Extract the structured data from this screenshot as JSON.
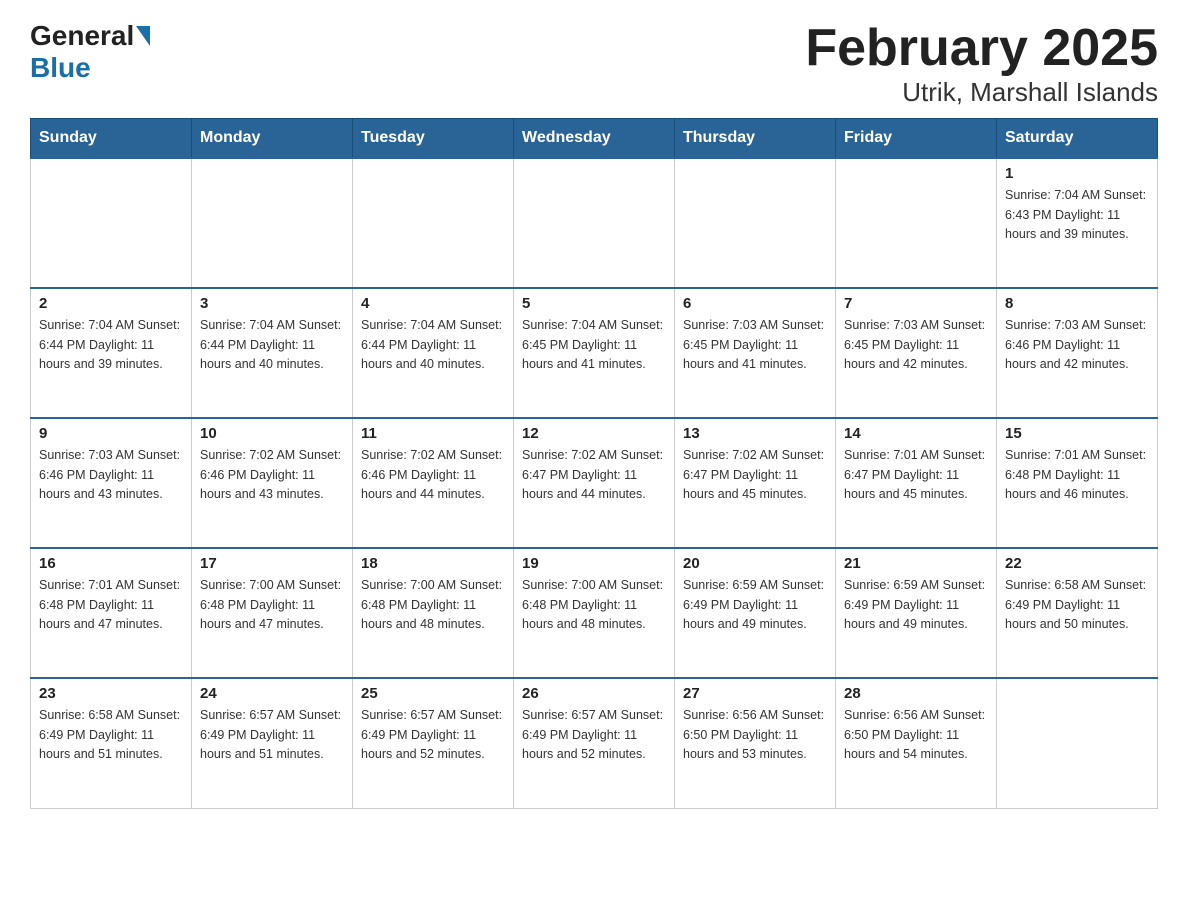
{
  "header": {
    "logo_general": "General",
    "logo_blue": "Blue",
    "title": "February 2025",
    "subtitle": "Utrik, Marshall Islands"
  },
  "weekdays": [
    "Sunday",
    "Monday",
    "Tuesday",
    "Wednesday",
    "Thursday",
    "Friday",
    "Saturday"
  ],
  "weeks": [
    [
      {
        "day": "",
        "info": ""
      },
      {
        "day": "",
        "info": ""
      },
      {
        "day": "",
        "info": ""
      },
      {
        "day": "",
        "info": ""
      },
      {
        "day": "",
        "info": ""
      },
      {
        "day": "",
        "info": ""
      },
      {
        "day": "1",
        "info": "Sunrise: 7:04 AM\nSunset: 6:43 PM\nDaylight: 11 hours\nand 39 minutes."
      }
    ],
    [
      {
        "day": "2",
        "info": "Sunrise: 7:04 AM\nSunset: 6:44 PM\nDaylight: 11 hours\nand 39 minutes."
      },
      {
        "day": "3",
        "info": "Sunrise: 7:04 AM\nSunset: 6:44 PM\nDaylight: 11 hours\nand 40 minutes."
      },
      {
        "day": "4",
        "info": "Sunrise: 7:04 AM\nSunset: 6:44 PM\nDaylight: 11 hours\nand 40 minutes."
      },
      {
        "day": "5",
        "info": "Sunrise: 7:04 AM\nSunset: 6:45 PM\nDaylight: 11 hours\nand 41 minutes."
      },
      {
        "day": "6",
        "info": "Sunrise: 7:03 AM\nSunset: 6:45 PM\nDaylight: 11 hours\nand 41 minutes."
      },
      {
        "day": "7",
        "info": "Sunrise: 7:03 AM\nSunset: 6:45 PM\nDaylight: 11 hours\nand 42 minutes."
      },
      {
        "day": "8",
        "info": "Sunrise: 7:03 AM\nSunset: 6:46 PM\nDaylight: 11 hours\nand 42 minutes."
      }
    ],
    [
      {
        "day": "9",
        "info": "Sunrise: 7:03 AM\nSunset: 6:46 PM\nDaylight: 11 hours\nand 43 minutes."
      },
      {
        "day": "10",
        "info": "Sunrise: 7:02 AM\nSunset: 6:46 PM\nDaylight: 11 hours\nand 43 minutes."
      },
      {
        "day": "11",
        "info": "Sunrise: 7:02 AM\nSunset: 6:46 PM\nDaylight: 11 hours\nand 44 minutes."
      },
      {
        "day": "12",
        "info": "Sunrise: 7:02 AM\nSunset: 6:47 PM\nDaylight: 11 hours\nand 44 minutes."
      },
      {
        "day": "13",
        "info": "Sunrise: 7:02 AM\nSunset: 6:47 PM\nDaylight: 11 hours\nand 45 minutes."
      },
      {
        "day": "14",
        "info": "Sunrise: 7:01 AM\nSunset: 6:47 PM\nDaylight: 11 hours\nand 45 minutes."
      },
      {
        "day": "15",
        "info": "Sunrise: 7:01 AM\nSunset: 6:48 PM\nDaylight: 11 hours\nand 46 minutes."
      }
    ],
    [
      {
        "day": "16",
        "info": "Sunrise: 7:01 AM\nSunset: 6:48 PM\nDaylight: 11 hours\nand 47 minutes."
      },
      {
        "day": "17",
        "info": "Sunrise: 7:00 AM\nSunset: 6:48 PM\nDaylight: 11 hours\nand 47 minutes."
      },
      {
        "day": "18",
        "info": "Sunrise: 7:00 AM\nSunset: 6:48 PM\nDaylight: 11 hours\nand 48 minutes."
      },
      {
        "day": "19",
        "info": "Sunrise: 7:00 AM\nSunset: 6:48 PM\nDaylight: 11 hours\nand 48 minutes."
      },
      {
        "day": "20",
        "info": "Sunrise: 6:59 AM\nSunset: 6:49 PM\nDaylight: 11 hours\nand 49 minutes."
      },
      {
        "day": "21",
        "info": "Sunrise: 6:59 AM\nSunset: 6:49 PM\nDaylight: 11 hours\nand 49 minutes."
      },
      {
        "day": "22",
        "info": "Sunrise: 6:58 AM\nSunset: 6:49 PM\nDaylight: 11 hours\nand 50 minutes."
      }
    ],
    [
      {
        "day": "23",
        "info": "Sunrise: 6:58 AM\nSunset: 6:49 PM\nDaylight: 11 hours\nand 51 minutes."
      },
      {
        "day": "24",
        "info": "Sunrise: 6:57 AM\nSunset: 6:49 PM\nDaylight: 11 hours\nand 51 minutes."
      },
      {
        "day": "25",
        "info": "Sunrise: 6:57 AM\nSunset: 6:49 PM\nDaylight: 11 hours\nand 52 minutes."
      },
      {
        "day": "26",
        "info": "Sunrise: 6:57 AM\nSunset: 6:49 PM\nDaylight: 11 hours\nand 52 minutes."
      },
      {
        "day": "27",
        "info": "Sunrise: 6:56 AM\nSunset: 6:50 PM\nDaylight: 11 hours\nand 53 minutes."
      },
      {
        "day": "28",
        "info": "Sunrise: 6:56 AM\nSunset: 6:50 PM\nDaylight: 11 hours\nand 54 minutes."
      },
      {
        "day": "",
        "info": ""
      }
    ]
  ]
}
